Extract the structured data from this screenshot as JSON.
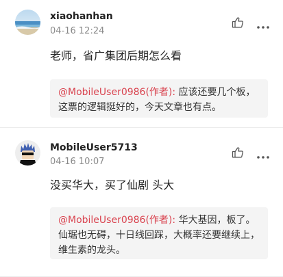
{
  "comments": [
    {
      "username": "xiaohanhan",
      "time": "04-16 12:24",
      "content": "老师，省广集团后期怎么看",
      "reply_author": "@MobileUser0986(作者):",
      "reply_text": " 应该还要几个板，这票的逻辑挺好的，今天文章也有点。"
    },
    {
      "username": "MobileUser5713",
      "time": "04-16 10:07",
      "content": "没买华大，买了仙剧 头大",
      "reply_author": "@MobileUser0986(作者):",
      "reply_text": " 华大基因，板了。仙琚也无碍，十日线回踩，大概率还要继续上，维生素的龙头。"
    }
  ],
  "colors": {
    "reply_author": "#d9424e",
    "quote_bg": "#f4f4f4",
    "time": "#8a8a8a"
  },
  "icons": {
    "like": "thumbs-up-icon",
    "more": "more-dots-icon"
  }
}
